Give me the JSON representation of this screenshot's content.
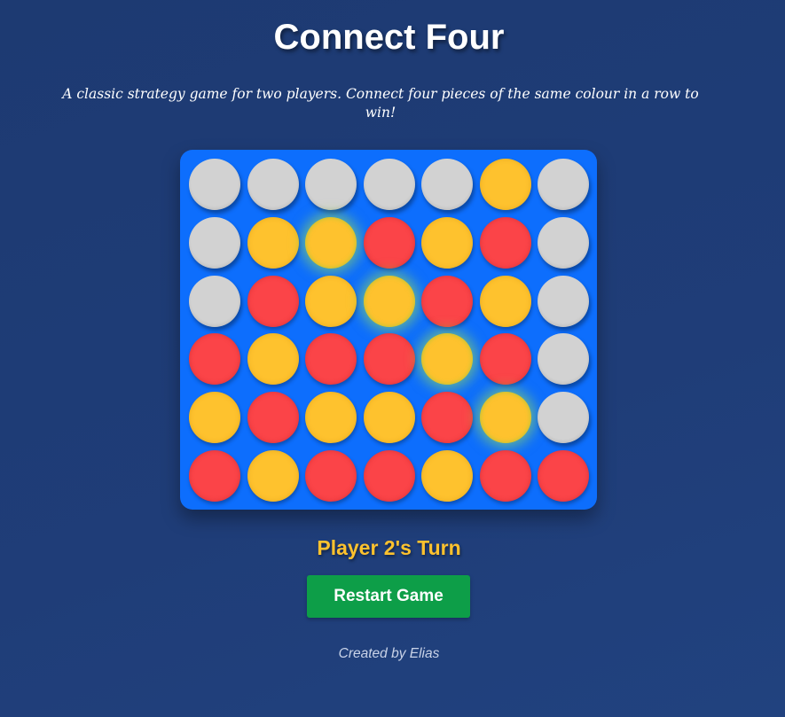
{
  "header": {
    "title": "Connect Four",
    "subtitle": "A classic strategy game for two players. Connect four pieces of the same colour in a row to win!"
  },
  "board": {
    "rows": 6,
    "columns": 7,
    "cells": [
      [
        "empty",
        "empty",
        "empty",
        "empty",
        "empty",
        "yellow",
        "empty"
      ],
      [
        "empty",
        "yellow",
        "yellow",
        "red",
        "yellow",
        "red",
        "empty"
      ],
      [
        "empty",
        "red",
        "yellow",
        "yellow",
        "red",
        "yellow",
        "empty"
      ],
      [
        "red",
        "yellow",
        "red",
        "red",
        "yellow",
        "red",
        "empty"
      ],
      [
        "yellow",
        "red",
        "yellow",
        "yellow",
        "red",
        "yellow",
        "empty"
      ],
      [
        "red",
        "yellow",
        "red",
        "red",
        "yellow",
        "red",
        "red"
      ]
    ],
    "winning_cells": [
      [
        1,
        2
      ],
      [
        2,
        3
      ],
      [
        3,
        4
      ],
      [
        4,
        5
      ]
    ],
    "colors": {
      "board": "#0d6efd",
      "empty": "#d2d2d2",
      "red": "#fb4448",
      "yellow": "#fec22e",
      "win_glow": "#a0e650"
    }
  },
  "status": {
    "turn_text": "Player 2's Turn",
    "turn_color": "#fec22e"
  },
  "controls": {
    "restart_label": "Restart Game",
    "restart_color": "#0d9e48"
  },
  "footer": {
    "credit": "Created by Elias"
  }
}
